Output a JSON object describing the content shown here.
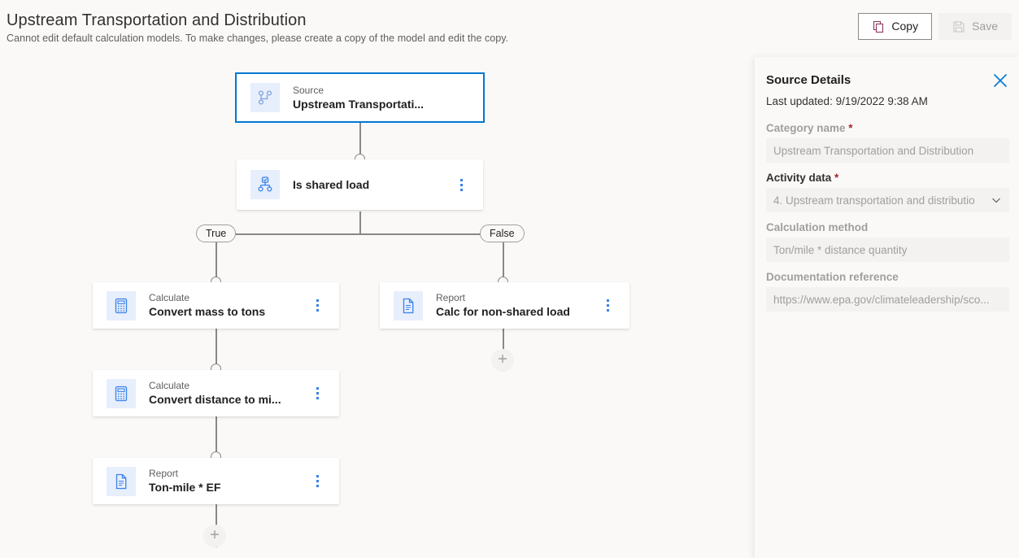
{
  "header": {
    "title": "Upstream Transportation and Distribution",
    "subtitle": "Cannot edit default calculation models. To make changes, please create a copy of the model and edit the copy.",
    "copy_label": "Copy",
    "copy_icon": "copy-icon",
    "save_label": "Save",
    "save_icon": "save-disk-icon",
    "save_disabled": true
  },
  "colors": {
    "accent": "#0078d4",
    "canvas_bg": "#faf9f8",
    "node_icon_bg": "#e7eefc",
    "icon_blue": "#3b82e8",
    "required_star": "#a4262c",
    "edge": "#8a8886",
    "copy_icon": "#8b3a62"
  },
  "flow": {
    "nodes": [
      {
        "id": "source",
        "kind": "Source",
        "name": "Upstream Transportati...",
        "icon": "branch-source-icon",
        "selected": true,
        "kebab": false
      },
      {
        "id": "decision",
        "kind": "",
        "name": "Is shared load",
        "icon": "condition-icon",
        "selected": false,
        "kebab": true
      },
      {
        "id": "calc1",
        "kind": "Calculate",
        "name": "Convert mass to tons",
        "icon": "calculator-icon",
        "selected": false,
        "kebab": true
      },
      {
        "id": "report1",
        "kind": "Report",
        "name": "Calc for non-shared load",
        "icon": "document-icon",
        "selected": false,
        "kebab": true
      },
      {
        "id": "calc2",
        "kind": "Calculate",
        "name": "Convert distance to mi...",
        "icon": "calculator-icon",
        "selected": false,
        "kebab": true
      },
      {
        "id": "report2",
        "kind": "Report",
        "name": "Ton-mile * EF",
        "icon": "document-icon",
        "selected": false,
        "kebab": true
      }
    ],
    "branch_labels": {
      "true": "True",
      "false": "False"
    },
    "add_buttons": [
      {
        "id": "add-false-branch",
        "label": "+"
      },
      {
        "id": "add-true-branch",
        "label": "+"
      }
    ]
  },
  "panel": {
    "title": "Source Details",
    "close_icon": "close-icon",
    "last_updated": "Last updated: 9/19/2022 9:38 AM",
    "fields": [
      {
        "id": "category-name",
        "label": "Category name",
        "required": true,
        "value": "Upstream Transportation and Distribution",
        "type": "text"
      },
      {
        "id": "activity-data",
        "label": "Activity data",
        "required": true,
        "value": "4. Upstream transportation and distributio",
        "type": "dropdown"
      },
      {
        "id": "calculation-method",
        "label": "Calculation method",
        "required": false,
        "value": "Ton/mile * distance quantity",
        "type": "text"
      },
      {
        "id": "documentation-reference",
        "label": "Documentation reference",
        "required": false,
        "value": "https://www.epa.gov/climateleadership/sco...",
        "type": "text"
      }
    ]
  }
}
